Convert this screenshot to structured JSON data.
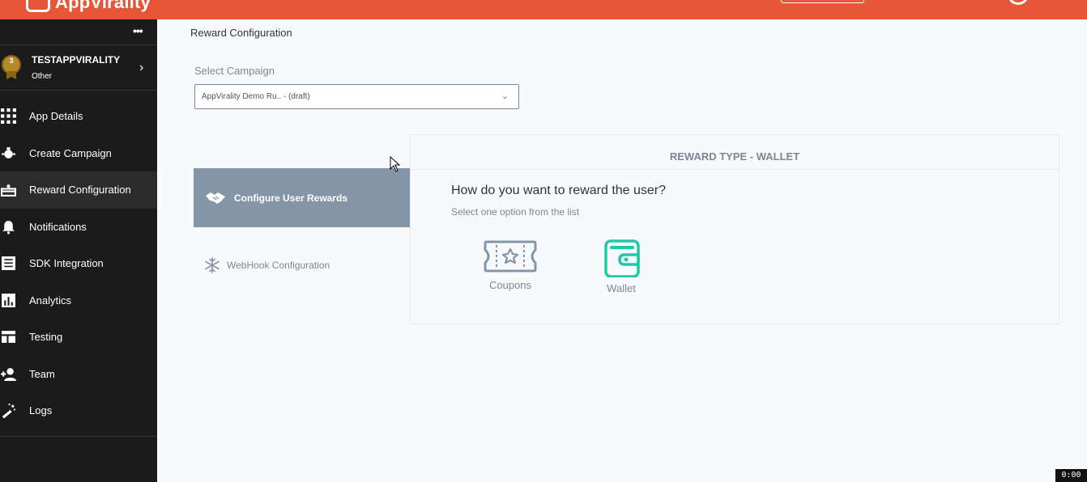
{
  "header": {
    "logo_text": "AppVirality"
  },
  "sidebar": {
    "app": {
      "name": "TESTAPPVIRALITY",
      "category": "Other",
      "badge": "3"
    },
    "items": [
      {
        "label": "App Details",
        "icon": "grid-icon"
      },
      {
        "label": "Create Campaign",
        "icon": "bulb-icon"
      },
      {
        "label": "Reward Configuration",
        "icon": "gift-icon",
        "active": true
      },
      {
        "label": "Notifications",
        "icon": "bell-icon"
      },
      {
        "label": "SDK Integration",
        "icon": "list-icon"
      },
      {
        "label": "Analytics",
        "icon": "bar-chart-icon"
      },
      {
        "label": "Testing",
        "icon": "layout-icon"
      },
      {
        "label": "Team",
        "icon": "add-user-icon"
      },
      {
        "label": "Logs",
        "icon": "wand-icon"
      }
    ]
  },
  "main": {
    "breadcrumb": "Reward Configuration",
    "campaign_label": "Select Campaign",
    "campaign_value": "AppVirality Demo Ru.. - (draft)",
    "tabs": [
      {
        "label": "Configure User Rewards",
        "active": true
      },
      {
        "label": "WebHook Configuration",
        "active": false
      }
    ],
    "panel": {
      "header": "REWARD TYPE - WALLET",
      "question": "How do you want to reward the user?",
      "hint": "Select one option from the list",
      "options": [
        {
          "label": "Coupons",
          "color": "#8595a8"
        },
        {
          "label": "Wallet",
          "color": "#1fc9a7"
        }
      ]
    }
  },
  "footer": {
    "timer": "0:00"
  },
  "colors": {
    "brand": "#e65637",
    "sidebar": "#1b1b1b",
    "accent": "#8595a8",
    "wallet": "#1fc9a7"
  }
}
